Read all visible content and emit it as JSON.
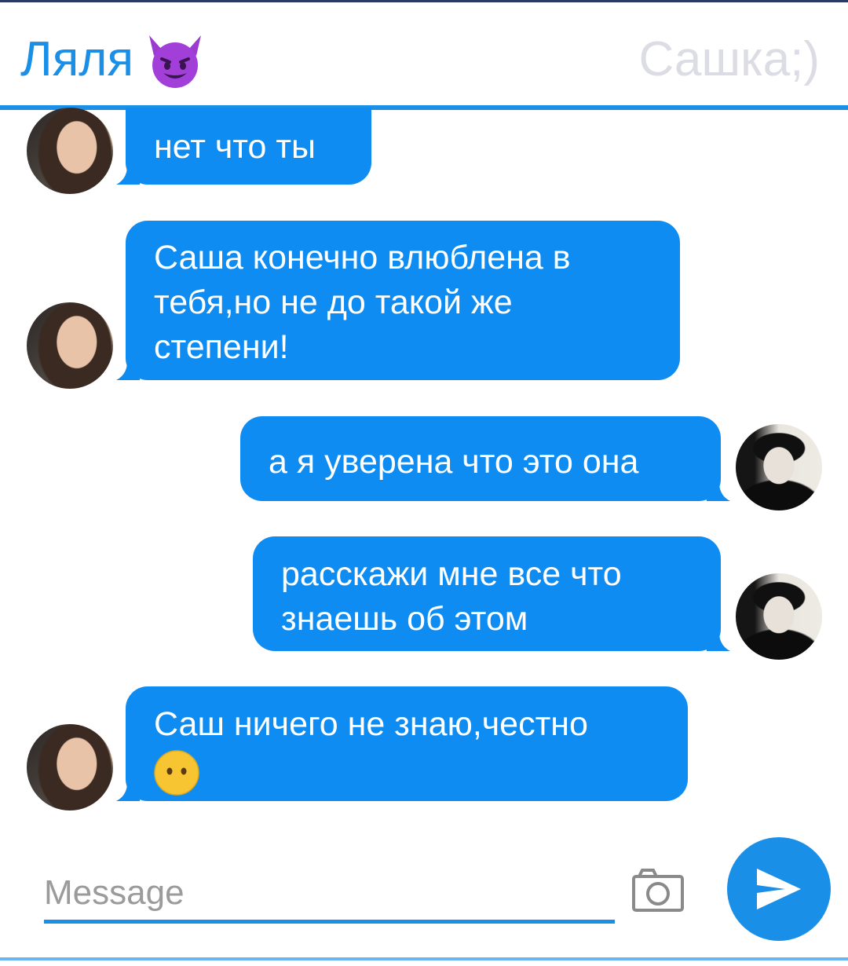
{
  "header": {
    "contact_name": "Ляля",
    "contact_emoji": "smiling-devil",
    "other_name": "Сашка;)",
    "accent_color": "#1a8fe8"
  },
  "messages": [
    {
      "side": "left",
      "text": "нет что ты"
    },
    {
      "side": "left",
      "text": "Саша конечно влюблена в\nтебя,но не до такой же\nстепени!"
    },
    {
      "side": "right",
      "text": "а я уверена что это она"
    },
    {
      "side": "right",
      "text": "расскажи мне все что\nзнаешь об этом"
    },
    {
      "side": "left",
      "text": "Саш ничего не знаю,честно",
      "emoji": "neutral-face"
    }
  ],
  "composer": {
    "placeholder": "Message",
    "value": "",
    "camera_icon": "camera-icon",
    "send_icon": "send-icon"
  },
  "colors": {
    "bubble": "#0f8cf2",
    "header_faded": "#dcdde4"
  }
}
